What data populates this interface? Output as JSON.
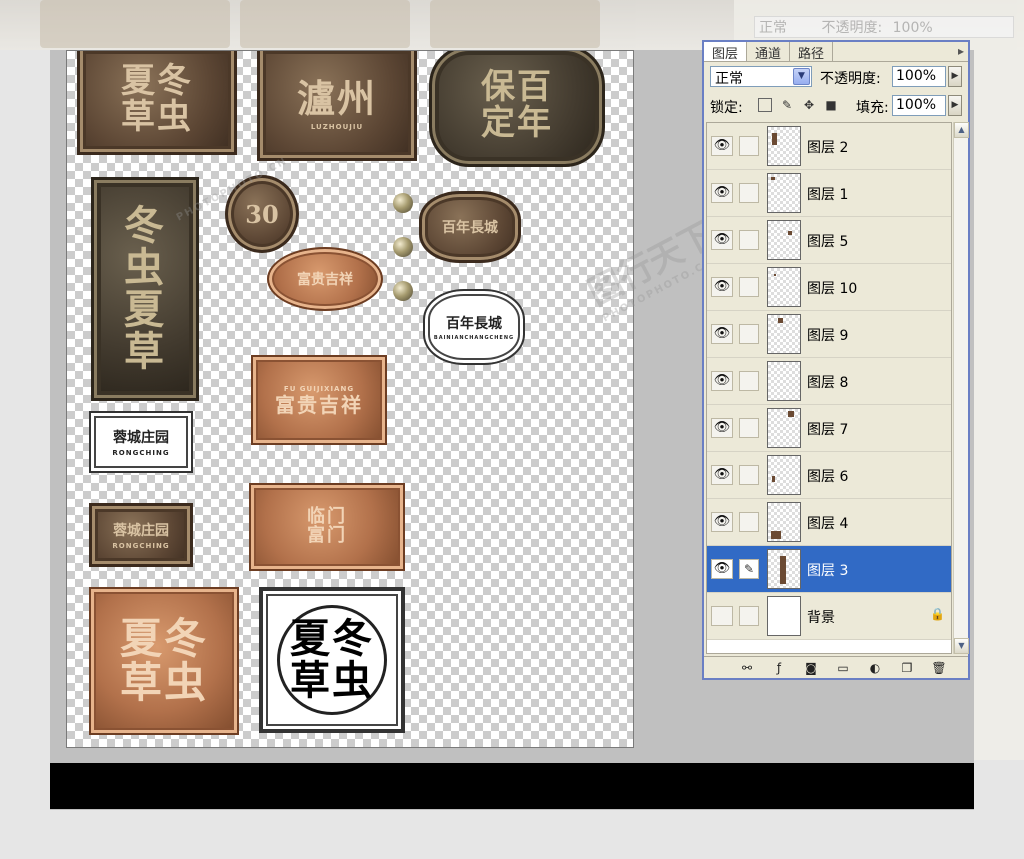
{
  "panel": {
    "tabs": [
      "图层",
      "通道",
      "路径"
    ],
    "blend_mode": "正常",
    "opacity_label": "不透明度:",
    "opacity_value": "100%",
    "lock_label": "锁定:",
    "fill_label": "填充:",
    "fill_value": "100%",
    "layers": [
      {
        "name": "图层 2",
        "visible": true,
        "selected": false
      },
      {
        "name": "图层 1",
        "visible": true,
        "selected": false
      },
      {
        "name": "图层 5",
        "visible": true,
        "selected": false
      },
      {
        "name": "图层 10",
        "visible": true,
        "selected": false
      },
      {
        "name": "图层 9",
        "visible": true,
        "selected": false
      },
      {
        "name": "图层 8",
        "visible": true,
        "selected": false
      },
      {
        "name": "图层 7",
        "visible": true,
        "selected": false
      },
      {
        "name": "图层 6",
        "visible": true,
        "selected": false
      },
      {
        "name": "图层 4",
        "visible": true,
        "selected": false
      },
      {
        "name": "图层 3",
        "visible": true,
        "selected": true
      },
      {
        "name": "背景",
        "visible": false,
        "selected": false
      }
    ],
    "footer_icons": [
      "link-icon",
      "fx-icon",
      "mask-icon",
      "folder-icon",
      "adjustment-icon",
      "new-layer-icon",
      "trash-icon"
    ]
  },
  "ghost": {
    "blend_mode": "正常",
    "opacity_label": "不透明度:",
    "opacity_value": "100%",
    "tabs": "图层 通道 路径"
  },
  "canvas": {
    "plaques": {
      "p1": "夏冬草虫",
      "p2": "瀘州",
      "p2_en": "LUZHOUJIU",
      "p3": "保百定年",
      "p4": "冬虫夏草",
      "p5": "30",
      "p6": "富贵吉祥",
      "p7": "百年長城",
      "p8": "百年長城",
      "p8_en": "BAINIANCHANGCHENG",
      "p9": "富贵吉祥",
      "p9_en": "FU GUIJIXIANG",
      "p10": "蓉城庄园",
      "p10_en": "RONGCHING",
      "p11": "蓉城庄园",
      "p11_en": "RONGCHING",
      "p12": "临门富门",
      "p13": "夏冬草虫",
      "p14": "夏冬草虫"
    }
  },
  "watermark": {
    "text": "图行天下",
    "sub": "PHOTOPHOTO.CN"
  }
}
